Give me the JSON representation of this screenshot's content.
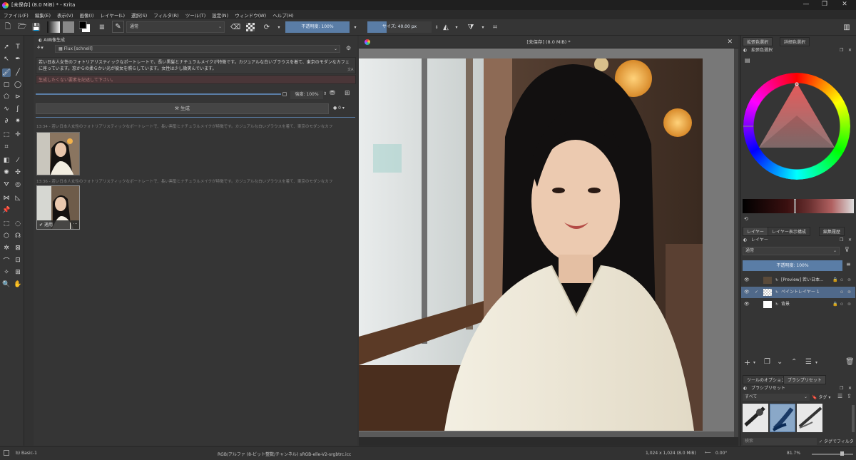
{
  "window": {
    "title": "[未保存] (8.0 MiB) * - Krita",
    "controls": [
      "—",
      "❐",
      "✕"
    ]
  },
  "menu": [
    "ファイル(F)",
    "編集(E)",
    "表示(V)",
    "画像(I)",
    "レイヤー(L)",
    "選択(S)",
    "フィルタ(R)",
    "ツール(T)",
    "設定(N)",
    "ウィンドウ(W)",
    "ヘルプ(H)"
  ],
  "toolbar": {
    "blend_mode": "通常",
    "opacity": "不透明度: 100%",
    "size": "サイズ: 40.00 px"
  },
  "ai_panel": {
    "title": "AI画像生成",
    "model": "Flux [schnell]",
    "prompt": "若い日本人女性のフォトリアリスティックなポートレートで、長い黒髪とナチュラルメイクが特徴です。カジュアルな白いブラウスを着て、東京のモダンなカフェに座っています。窓からの柔らかい光が彼女を照らしています。女性は少し微笑んでいます。",
    "negative_placeholder": "生成したくない要素を記述して下さい。",
    "strength": "強度: 100%",
    "generate_label": "生成",
    "queue_count": "0",
    "history": [
      {
        "time": "13:34",
        "text": "若い日本人女性のフォトリアリスティックなポートレートで、長い黒髪とナチュラルメイクが特徴です。カジュアルな白いブラウスを着て、東京のモダンなカフ"
      },
      {
        "time": "13:36",
        "text": "若い日本人女性のフォトリアリスティックなポートレートで、長い黒髪とナチュラルメイクが特徴です。カジュアルな白いブラウスを着て、東京のモダンなカフ"
      }
    ],
    "apply_label": "適用",
    "more_label": "···"
  },
  "canvas": {
    "tab_title": "[未保存] (8.0 MiB) *"
  },
  "color_docker": {
    "tabs": [
      "拡張色選択",
      "詳細色選択"
    ],
    "title": "拡張色選択"
  },
  "layers_docker": {
    "tabs": [
      "レイヤー",
      "レイヤー表示構成",
      "編集履歴"
    ],
    "title": "レイヤー",
    "blend": "通常",
    "opacity": "不透明度: 100%",
    "layers": [
      {
        "name": "[Preview] 若い日本..."
      },
      {
        "name": "ペイントレイヤー 1"
      },
      {
        "name": "背景"
      }
    ]
  },
  "brush_docker": {
    "tabs": [
      "ツールのオプション",
      "ブラシプリセット"
    ],
    "title": "ブラシプリセット",
    "filter": "すべて",
    "tag": "タグ",
    "search_placeholder": "検索",
    "tag_filter": "タグでフィルタ"
  },
  "status": {
    "preset": "b) Basic-1",
    "color_space": "RGB/アルファ (8-ビット整数/チャンネル)  sRGB-elle-V2-srgbtrc.icc",
    "dims": "1,024 x 1,024 (8.0 MiB)",
    "rotation": "0.00°",
    "zoom": "81.7%"
  },
  "colors": {
    "accent": "#5a7da6",
    "selection": "#50698a",
    "panel": "#353535"
  }
}
